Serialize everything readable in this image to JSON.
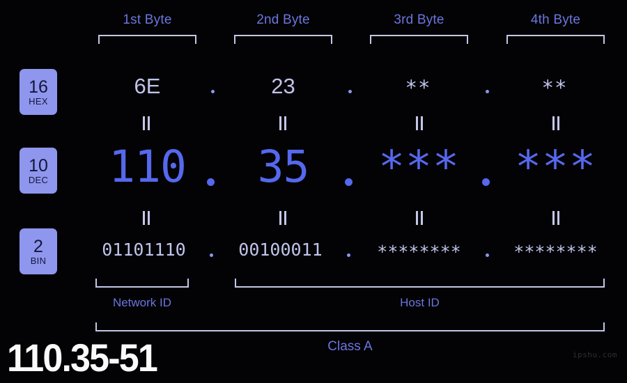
{
  "page": {
    "title": "110.35-51",
    "watermark": "ipshu.com",
    "background_color": "#030305",
    "accent_blue": "#5568EE",
    "accent_lavender": "#BFC4EA",
    "badge_bg": "#8E96EE",
    "badge_text": "#14163A",
    "label_color": "#6B76DE",
    "bracket_color": "#C3C7E8"
  },
  "byte_headers": [
    {
      "label": "1st Byte"
    },
    {
      "label": "2nd Byte"
    },
    {
      "label": "3rd Byte"
    },
    {
      "label": "4th Byte"
    }
  ],
  "bases": [
    {
      "number": "16",
      "name": "HEX"
    },
    {
      "number": "10",
      "name": "DEC"
    },
    {
      "number": "2",
      "name": "BIN"
    }
  ],
  "rows": {
    "hex": {
      "base": "16",
      "base_name": "HEX",
      "values": [
        "6E",
        "23",
        "**",
        "**"
      ],
      "separator": "."
    },
    "dec": {
      "base": "10",
      "base_name": "DEC",
      "values": [
        "110",
        "35",
        "***",
        "***"
      ],
      "separator": "."
    },
    "bin": {
      "base": "2",
      "base_name": "BIN",
      "values": [
        "01101110",
        "00100011",
        "********",
        "********"
      ],
      "separator": "."
    }
  },
  "equals_marks": {
    "symbol": "=",
    "count_per_gap": 4,
    "gaps": [
      "hex-to-dec",
      "dec-to-bin"
    ]
  },
  "id_sections": [
    {
      "label": "Network ID"
    },
    {
      "label": "Host ID"
    }
  ],
  "class_section": {
    "label": "Class A"
  }
}
